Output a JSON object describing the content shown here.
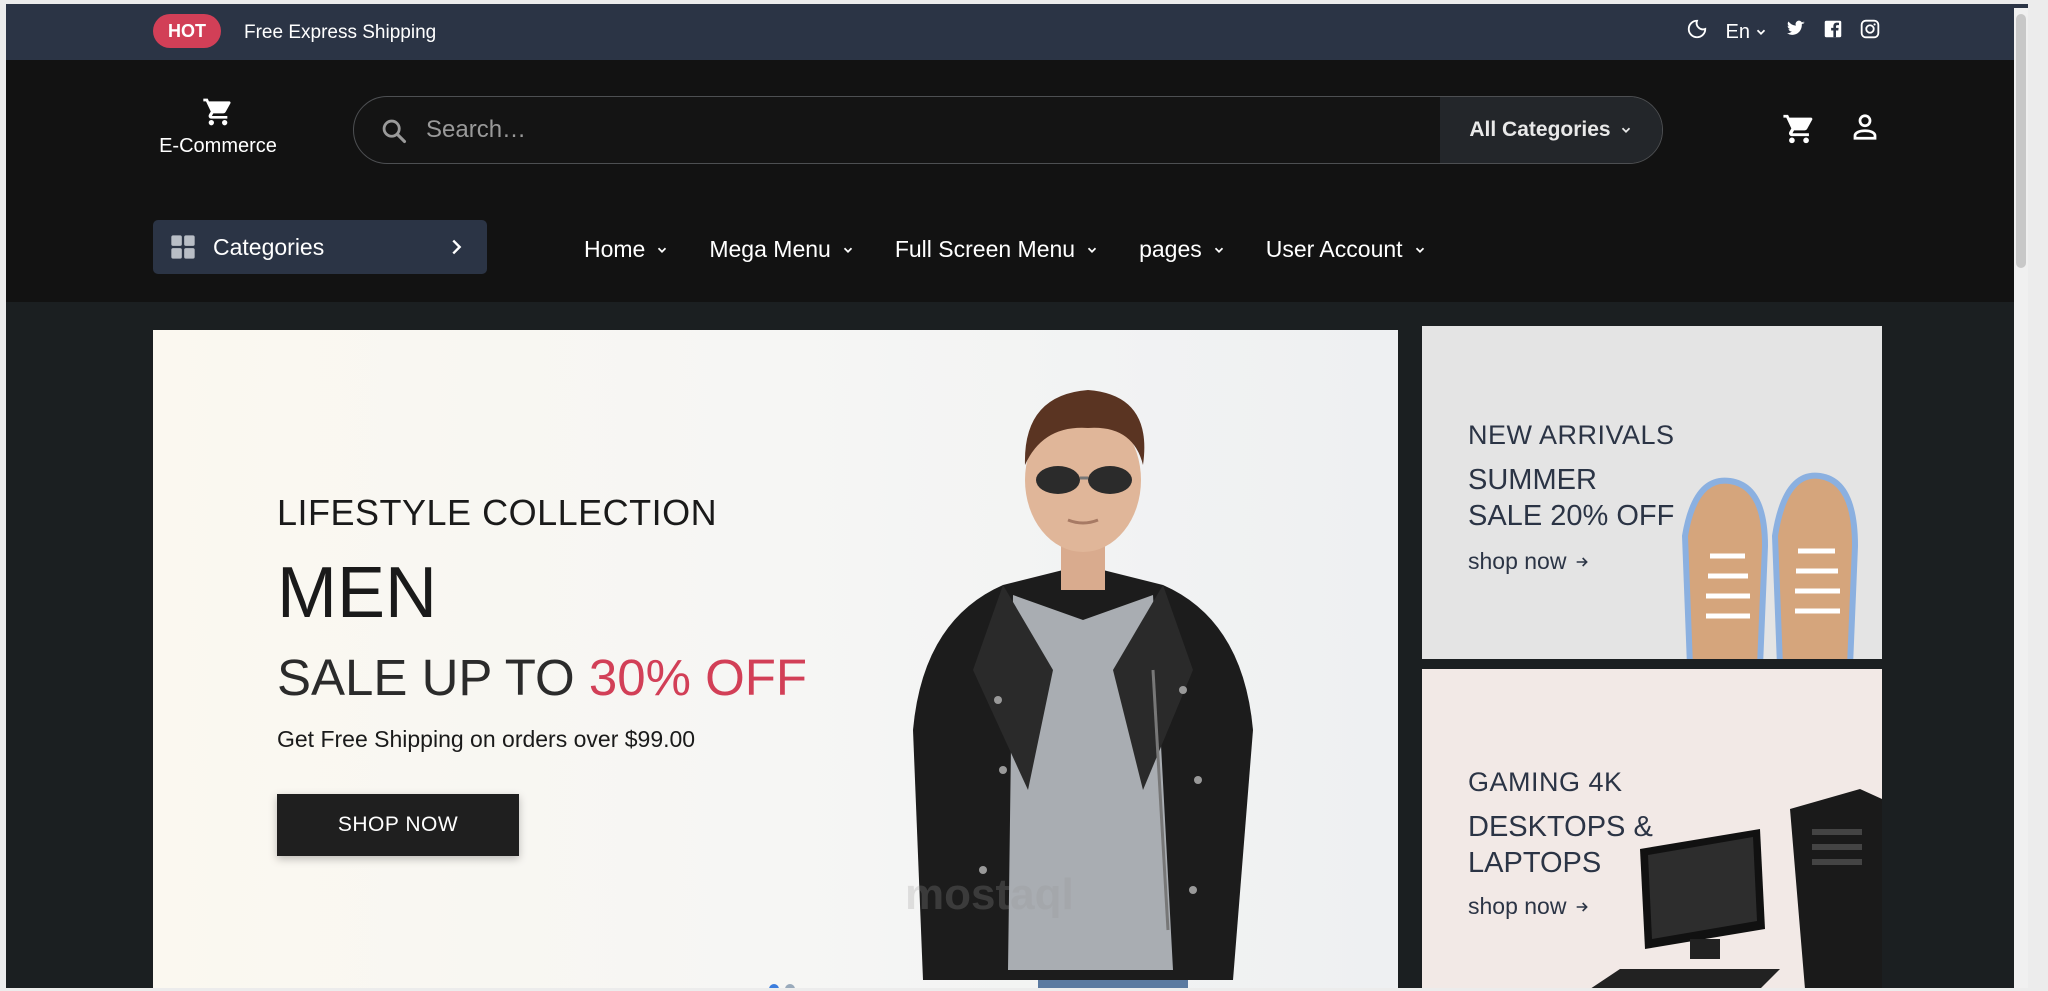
{
  "topbar": {
    "badge": "HOT",
    "shipping": "Free Express Shipping",
    "language": "En",
    "icons": [
      "moon-icon",
      "twitter-icon",
      "facebook-icon",
      "instagram-icon"
    ]
  },
  "header": {
    "logo_text": "E-Commerce",
    "search_placeholder": "Search…",
    "category_select": "All Categories"
  },
  "nav": {
    "categories_label": "Categories",
    "menu": [
      {
        "label": "Home"
      },
      {
        "label": "Mega Menu"
      },
      {
        "label": "Full Screen Menu"
      },
      {
        "label": "pages"
      },
      {
        "label": "User Account"
      }
    ]
  },
  "hero": {
    "subtitle": "LIFESTYLE COLLECTION",
    "title": "MEN",
    "sale_prefix": "SALE UP TO",
    "sale_percent": "30% OFF",
    "shipping_note": "Get Free Shipping on orders over $99.00",
    "button": "SHOP NOW"
  },
  "banners": [
    {
      "tag": "NEW ARRIVALS",
      "line1": "SUMMER",
      "line2": "SALE 20% OFF",
      "link": "shop now"
    },
    {
      "tag": "GAMING 4K",
      "line1": "DESKTOPS &",
      "line2": "LAPTOPS",
      "link": "shop now"
    }
  ],
  "colors": {
    "accent": "#d23f57",
    "topbar": "#2b3445",
    "header": "#121212",
    "page_bg": "#1b1f21"
  }
}
